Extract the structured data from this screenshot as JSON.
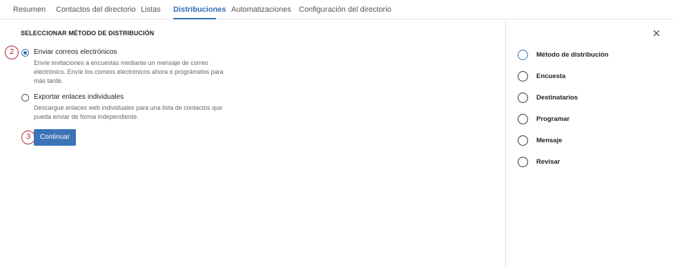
{
  "tabs": [
    {
      "label": "Resumen"
    },
    {
      "label": "Contactos del directorio"
    },
    {
      "label": "Listas"
    },
    {
      "label": "Distribuciones",
      "active": true
    },
    {
      "label": "Automatizaciones"
    },
    {
      "label": "Configuración del directorio"
    }
  ],
  "main": {
    "section_title": "SELECCIONAR MÉTODO DE DISTRIBUCIÓN",
    "options": [
      {
        "label": "Enviar correos electrónicos",
        "selected": true,
        "description": "Envíe invitaciones a encuestas mediante un mensaje de correo electrónico. Envíe los correos electrónicos ahora o prográmelos para más tarde."
      },
      {
        "label": "Exportar enlaces individuales",
        "selected": false,
        "description": "Descargue enlaces web individuales para una lista de contactos que pueda enviar de forma independiente."
      }
    ],
    "continue_label": "Continuar",
    "badges": [
      "2",
      "3"
    ]
  },
  "sidebar": {
    "close_icon": "close-icon",
    "steps": [
      {
        "label": "Método de distribución",
        "current": true
      },
      {
        "label": "Encuesta"
      },
      {
        "label": "Destinatarios"
      },
      {
        "label": "Programar"
      },
      {
        "label": "Mensaje"
      },
      {
        "label": "Revisar"
      }
    ]
  },
  "colors": {
    "accent": "#2f6fb5",
    "button": "#3b73b7",
    "annotation": "#b0272f"
  }
}
